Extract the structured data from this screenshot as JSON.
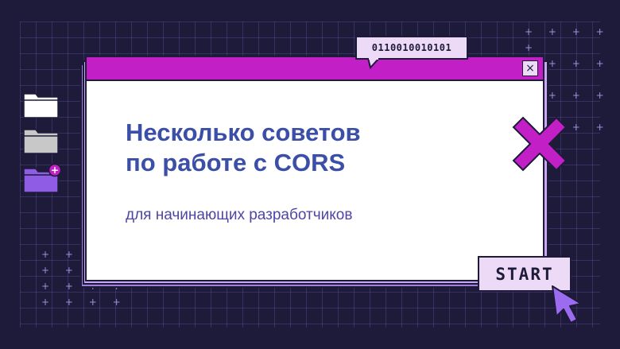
{
  "bubble": {
    "text": "0110010010101"
  },
  "window": {
    "close_symbol": "×"
  },
  "heading": {
    "line1": "Несколько советов",
    "line2": "по работе с CORS"
  },
  "subheading": "для начинающих разработчиков",
  "start_button": {
    "label": "START"
  },
  "folder_badge": "+",
  "icons": [
    "folder-icon",
    "folder-icon",
    "folder-plus-icon",
    "close-icon",
    "cross-icon",
    "cursor-icon"
  ],
  "colors": {
    "background": "#1e1a3a",
    "accent_magenta": "#c21fc7",
    "lavender": "#ecdaf7",
    "violet": "#a07de0",
    "heading_blue": "#3b4fa8",
    "subheading_purple": "#4f45a6"
  }
}
